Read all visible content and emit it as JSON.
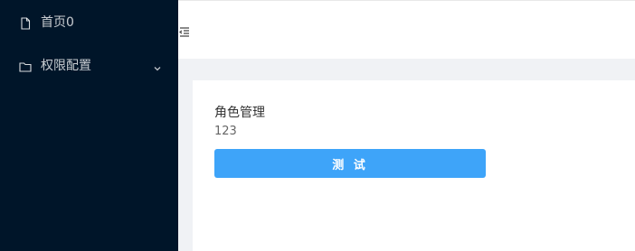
{
  "sidebar": {
    "items": [
      {
        "label": "首页0",
        "icon": "file-icon"
      },
      {
        "label": "权限配置",
        "icon": "folder-icon",
        "expandable": true
      }
    ]
  },
  "header": {
    "toggle_icon": "menu-fold-icon"
  },
  "main": {
    "card": {
      "title": "角色管理",
      "value": "123",
      "button_label": "测 试"
    }
  },
  "colors": {
    "sidebar_bg": "#001529",
    "primary_button": "#3ea4f9",
    "page_bg": "#f0f2f5"
  }
}
